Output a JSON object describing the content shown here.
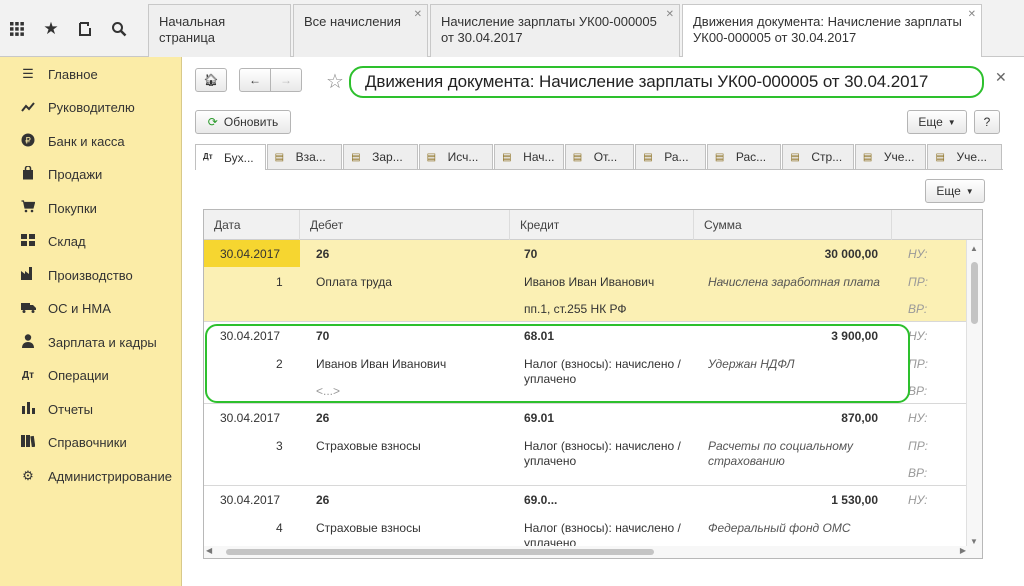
{
  "topbar": {
    "tabs": [
      {
        "label": "Начальная страница",
        "closable": false
      },
      {
        "label": "Все начисления",
        "closable": true
      },
      {
        "label": "Начисление зарплаты УК00-000005 от 30.04.2017",
        "closable": true
      },
      {
        "label": "Движения документа: Начисление зарплаты УК00-000005 от 30.04.2017",
        "closable": true
      }
    ]
  },
  "sidebar": {
    "items": [
      {
        "label": "Главное",
        "icon": "menu-icon"
      },
      {
        "label": "Руководителю",
        "icon": "trend-icon"
      },
      {
        "label": "Банк и касса",
        "icon": "ruble-icon"
      },
      {
        "label": "Продажи",
        "icon": "bag-icon"
      },
      {
        "label": "Покупки",
        "icon": "cart-icon"
      },
      {
        "label": "Склад",
        "icon": "warehouse-icon"
      },
      {
        "label": "Производство",
        "icon": "factory-icon"
      },
      {
        "label": "ОС и НМА",
        "icon": "truck-icon"
      },
      {
        "label": "Зарплата и кадры",
        "icon": "person-icon"
      },
      {
        "label": "Операции",
        "icon": "dt-kt-icon"
      },
      {
        "label": "Отчеты",
        "icon": "bar-chart-icon"
      },
      {
        "label": "Справочники",
        "icon": "books-icon"
      },
      {
        "label": "Администрирование",
        "icon": "gear-icon"
      }
    ]
  },
  "main": {
    "title": "Движения документа: Начисление зарплаты УК00-000005 от 30.04.2017",
    "refresh_label": "Обновить",
    "more_label": "Еще",
    "more_label2": "Еще",
    "help_label": "?",
    "doc_tabs": [
      "Бух...",
      "Вза...",
      "Зар...",
      "Исч...",
      "Нач...",
      "От...",
      "Ра...",
      "Рас...",
      "Стр...",
      "Уче...",
      "Уче..."
    ]
  },
  "table": {
    "headers": [
      "Дата",
      "Дебет",
      "Кредит",
      "Сумма"
    ],
    "rows": [
      {
        "date": "30.04.2017",
        "num": "1",
        "debit": "26",
        "debit2": "Оплата труда",
        "debit3": "",
        "credit": "70",
        "credit2": "Иванов Иван Иванович",
        "credit3": "пп.1, ст.255 НК РФ",
        "sum": "30 000,00",
        "content": "Начислена заработная плата",
        "nu": "НУ:",
        "pr": "ПР:",
        "vr": "ВР:"
      },
      {
        "date": "30.04.2017",
        "num": "2",
        "debit": "70",
        "debit2": "Иванов Иван Иванович",
        "debit3": "<...>",
        "credit": "68.01",
        "credit2": "Налог (взносы): начислено / уплачено",
        "credit3": "",
        "sum": "3 900,00",
        "content": "Удержан НДФЛ",
        "nu": "НУ:",
        "pr": "ПР:",
        "vr": "ВР:"
      },
      {
        "date": "30.04.2017",
        "num": "3",
        "debit": "26",
        "debit2": "Страховые взносы",
        "debit3": "",
        "credit": "69.01",
        "credit2": "Налог (взносы): начислено / уплачено",
        "credit3": "",
        "sum": "870,00",
        "content": "Расчеты по социальному страхованию",
        "nu": "НУ:",
        "pr": "ПР:",
        "vr": "ВР:"
      },
      {
        "date": "30.04.2017",
        "num": "4",
        "debit": "26",
        "debit2": "Страховые взносы",
        "debit3": "",
        "credit": "69.0...",
        "credit2": "Налог (взносы): начислено / уплачено",
        "credit3": "",
        "sum": "1 530,00",
        "content": "Федеральный фонд ОМС",
        "nu": "НУ:",
        "pr": "",
        "vr": ""
      }
    ]
  }
}
